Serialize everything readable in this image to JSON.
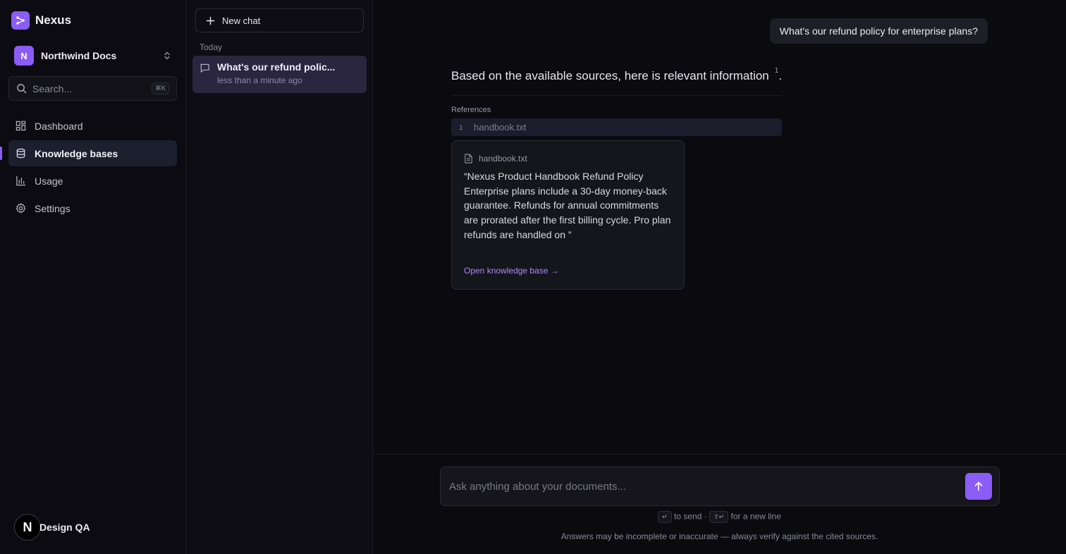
{
  "colors": {
    "accent": "#8b5cf6",
    "link": "#a78bfa",
    "active_chat": "#2a2640"
  },
  "app": {
    "name": "Nexus"
  },
  "workspace": {
    "initial": "N",
    "name": "Northwind Docs"
  },
  "search": {
    "placeholder": "Search...",
    "shortcut": "⌘K"
  },
  "nav": [
    {
      "label": "Dashboard",
      "icon": "dashboard-icon"
    },
    {
      "label": "Knowledge bases",
      "icon": "database-icon",
      "active": true
    },
    {
      "label": "Usage",
      "icon": "bar-chart-icon"
    },
    {
      "label": "Settings",
      "icon": "gear-icon"
    }
  ],
  "user": {
    "initial": "N",
    "name": "Design QA"
  },
  "chats": {
    "new_chat_label": "New chat",
    "group_label": "Today",
    "items": [
      {
        "title": "What's our refund polic...",
        "time": "less than a minute ago"
      }
    ]
  },
  "conversation": {
    "user_message": "What's our refund policy for enterprise plans?",
    "answer_text": "Based on the available sources, here is relevant information",
    "answer_citation": "1",
    "answer_end": ".",
    "references_label": "References",
    "references": [
      {
        "num": "1",
        "name": "handbook.txt"
      }
    ],
    "popover": {
      "file": "handbook.txt",
      "excerpt": "“Nexus Product Handbook Refund Policy Enterprise plans include a 30-day money-back guarantee. Refunds for annual commitments are prorated after the first billing cycle. Pro plan refunds are handled on ”",
      "link": "Open knowledge base →"
    }
  },
  "composer": {
    "placeholder": "Ask anything about your documents...",
    "send_key": "↵",
    "send_text": "to send ·",
    "newline_key": "⇧↵",
    "newline_text": "for a new line",
    "disclaimer": "Answers may be incomplete or inaccurate — always verify against the cited sources."
  }
}
